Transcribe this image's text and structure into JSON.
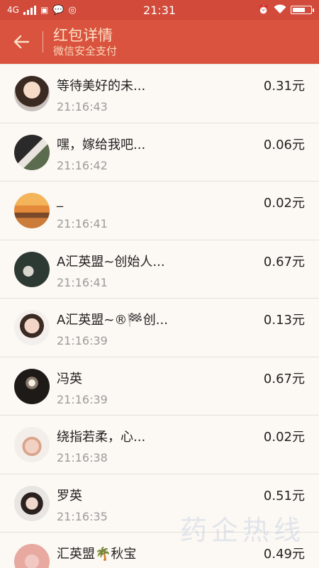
{
  "status_bar": {
    "network": "4G",
    "time": "21:31"
  },
  "header": {
    "title": "红包详情",
    "subtitle": "微信安全支付"
  },
  "records": [
    {
      "name": "等待美好的未...",
      "time": "21:16:43",
      "amount": "0.31元",
      "avatar": "avatar-photo-icon"
    },
    {
      "name": "嘿，嫁给我吧...",
      "time": "21:16:42",
      "amount": "0.06元",
      "avatar": "avatar-photo-icon"
    },
    {
      "name": "_",
      "time": "21:16:41",
      "amount": "0.02元",
      "avatar": "avatar-sunset-icon"
    },
    {
      "name": "A汇英盟~创始人...",
      "time": "21:16:41",
      "amount": "0.67元",
      "avatar": "avatar-photo-icon"
    },
    {
      "name": "A汇英盟~®🏁创...",
      "time": "21:16:39",
      "amount": "0.13元",
      "avatar": "avatar-photo-icon"
    },
    {
      "name": "冯英",
      "time": "21:16:39",
      "amount": "0.67元",
      "avatar": "avatar-fireworks-icon"
    },
    {
      "name": "绕指若柔，心...",
      "time": "21:16:38",
      "amount": "0.02元",
      "avatar": "avatar-photo-icon"
    },
    {
      "name": "罗英",
      "time": "21:16:35",
      "amount": "0.51元",
      "avatar": "avatar-photo-icon"
    },
    {
      "name": "汇英盟🌴秋宝",
      "time": "",
      "amount": "0.49元",
      "avatar": "avatar-photo-icon"
    }
  ],
  "watermark": "药企热线"
}
